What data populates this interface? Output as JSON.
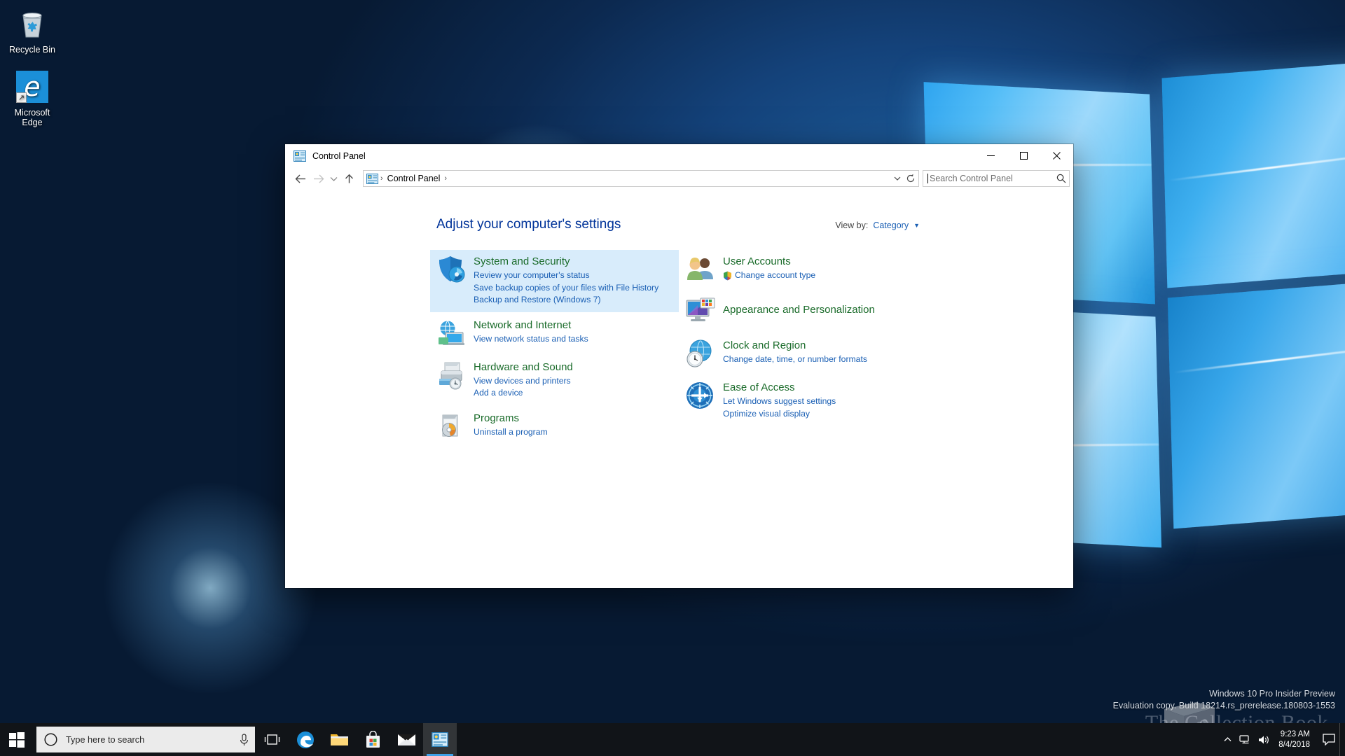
{
  "desktop": {
    "icons": [
      {
        "name": "recycle-bin",
        "label": "Recycle Bin"
      },
      {
        "name": "microsoft-edge",
        "label": "Microsoft\nEdge",
        "line1": "Microsoft",
        "line2": "Edge"
      }
    ],
    "watermark": {
      "line1": "Windows 10 Pro Insider Preview",
      "line2": "Evaluation copy. Build 18214.rs_prerelease.180803-1553"
    },
    "overlay_text": "The Collection Book"
  },
  "window": {
    "title": "Control Panel",
    "controls": {
      "minimize": "Minimize",
      "maximize": "Maximize",
      "close": "Close"
    },
    "nav": {
      "back": "Back",
      "forward": "Forward",
      "recent": "Recent locations",
      "up": "Up",
      "refresh": "Refresh",
      "address_dropdown": "Previous locations"
    },
    "breadcrumb": [
      {
        "label": "Control Panel"
      }
    ],
    "search": {
      "placeholder": "Search Control Panel",
      "value": "",
      "icon": "search-icon"
    }
  },
  "main": {
    "heading": "Adjust your computer's settings",
    "view_by": {
      "label": "View by:",
      "value": "Category"
    },
    "categories_left": [
      {
        "id": "system-and-security",
        "title": "System and Security",
        "highlighted": true,
        "icon": "shield-icon",
        "links": [
          "Review your computer's status",
          "Save backup copies of your files with File History",
          "Backup and Restore (Windows 7)"
        ]
      },
      {
        "id": "network-and-internet",
        "title": "Network and Internet",
        "highlighted": false,
        "icon": "network-globe-icon",
        "links": [
          "View network status and tasks"
        ]
      },
      {
        "id": "hardware-and-sound",
        "title": "Hardware and Sound",
        "highlighted": false,
        "icon": "printer-icon",
        "links": [
          "View devices and printers",
          "Add a device"
        ]
      },
      {
        "id": "programs",
        "title": "Programs",
        "highlighted": false,
        "icon": "programs-disc-icon",
        "links": [
          "Uninstall a program"
        ]
      }
    ],
    "categories_right": [
      {
        "id": "user-accounts",
        "title": "User Accounts",
        "icon": "users-icon",
        "links": [
          "Change account type"
        ],
        "link_shield": true
      },
      {
        "id": "appearance-and-personalization",
        "title": "Appearance and Personalization",
        "icon": "monitor-palette-icon",
        "links": []
      },
      {
        "id": "clock-and-region",
        "title": "Clock and Region",
        "icon": "clock-globe-icon",
        "links": [
          "Change date, time, or number formats"
        ]
      },
      {
        "id": "ease-of-access",
        "title": "Ease of Access",
        "icon": "ease-of-access-icon",
        "links": [
          "Let Windows suggest settings",
          "Optimize visual display"
        ]
      }
    ]
  },
  "taskbar": {
    "start": "Start",
    "search": {
      "placeholder": "Type here to search",
      "circle_icon": "cortana-circle-icon",
      "mic_icon": "microphone-icon"
    },
    "buttons": [
      {
        "id": "task-view",
        "label": "Task View",
        "icon": "task-view-icon"
      },
      {
        "id": "edge",
        "label": "Microsoft Edge",
        "icon": "edge-icon"
      },
      {
        "id": "file-explorer",
        "label": "File Explorer",
        "icon": "folder-icon"
      },
      {
        "id": "microsoft-store",
        "label": "Microsoft Store",
        "icon": "store-bag-icon"
      },
      {
        "id": "mail",
        "label": "Mail",
        "icon": "mail-envelope-icon"
      },
      {
        "id": "control-panel",
        "label": "Control Panel",
        "icon": "control-panel-icon",
        "active": true
      }
    ],
    "tray": {
      "chevron": "Show hidden icons",
      "network_icon": "network-icon",
      "volume_icon": "speaker-icon",
      "time": "9:23 AM",
      "date": "8/4/2018",
      "action_center": "Action Center"
    }
  },
  "colors": {
    "accent": "#1a5fb4",
    "category_title": "#1a6b2a",
    "heading": "#003399",
    "highlight_bg": "#d8ecfb",
    "taskbar_bg": "#111418",
    "window_bg": "#ffffff"
  }
}
